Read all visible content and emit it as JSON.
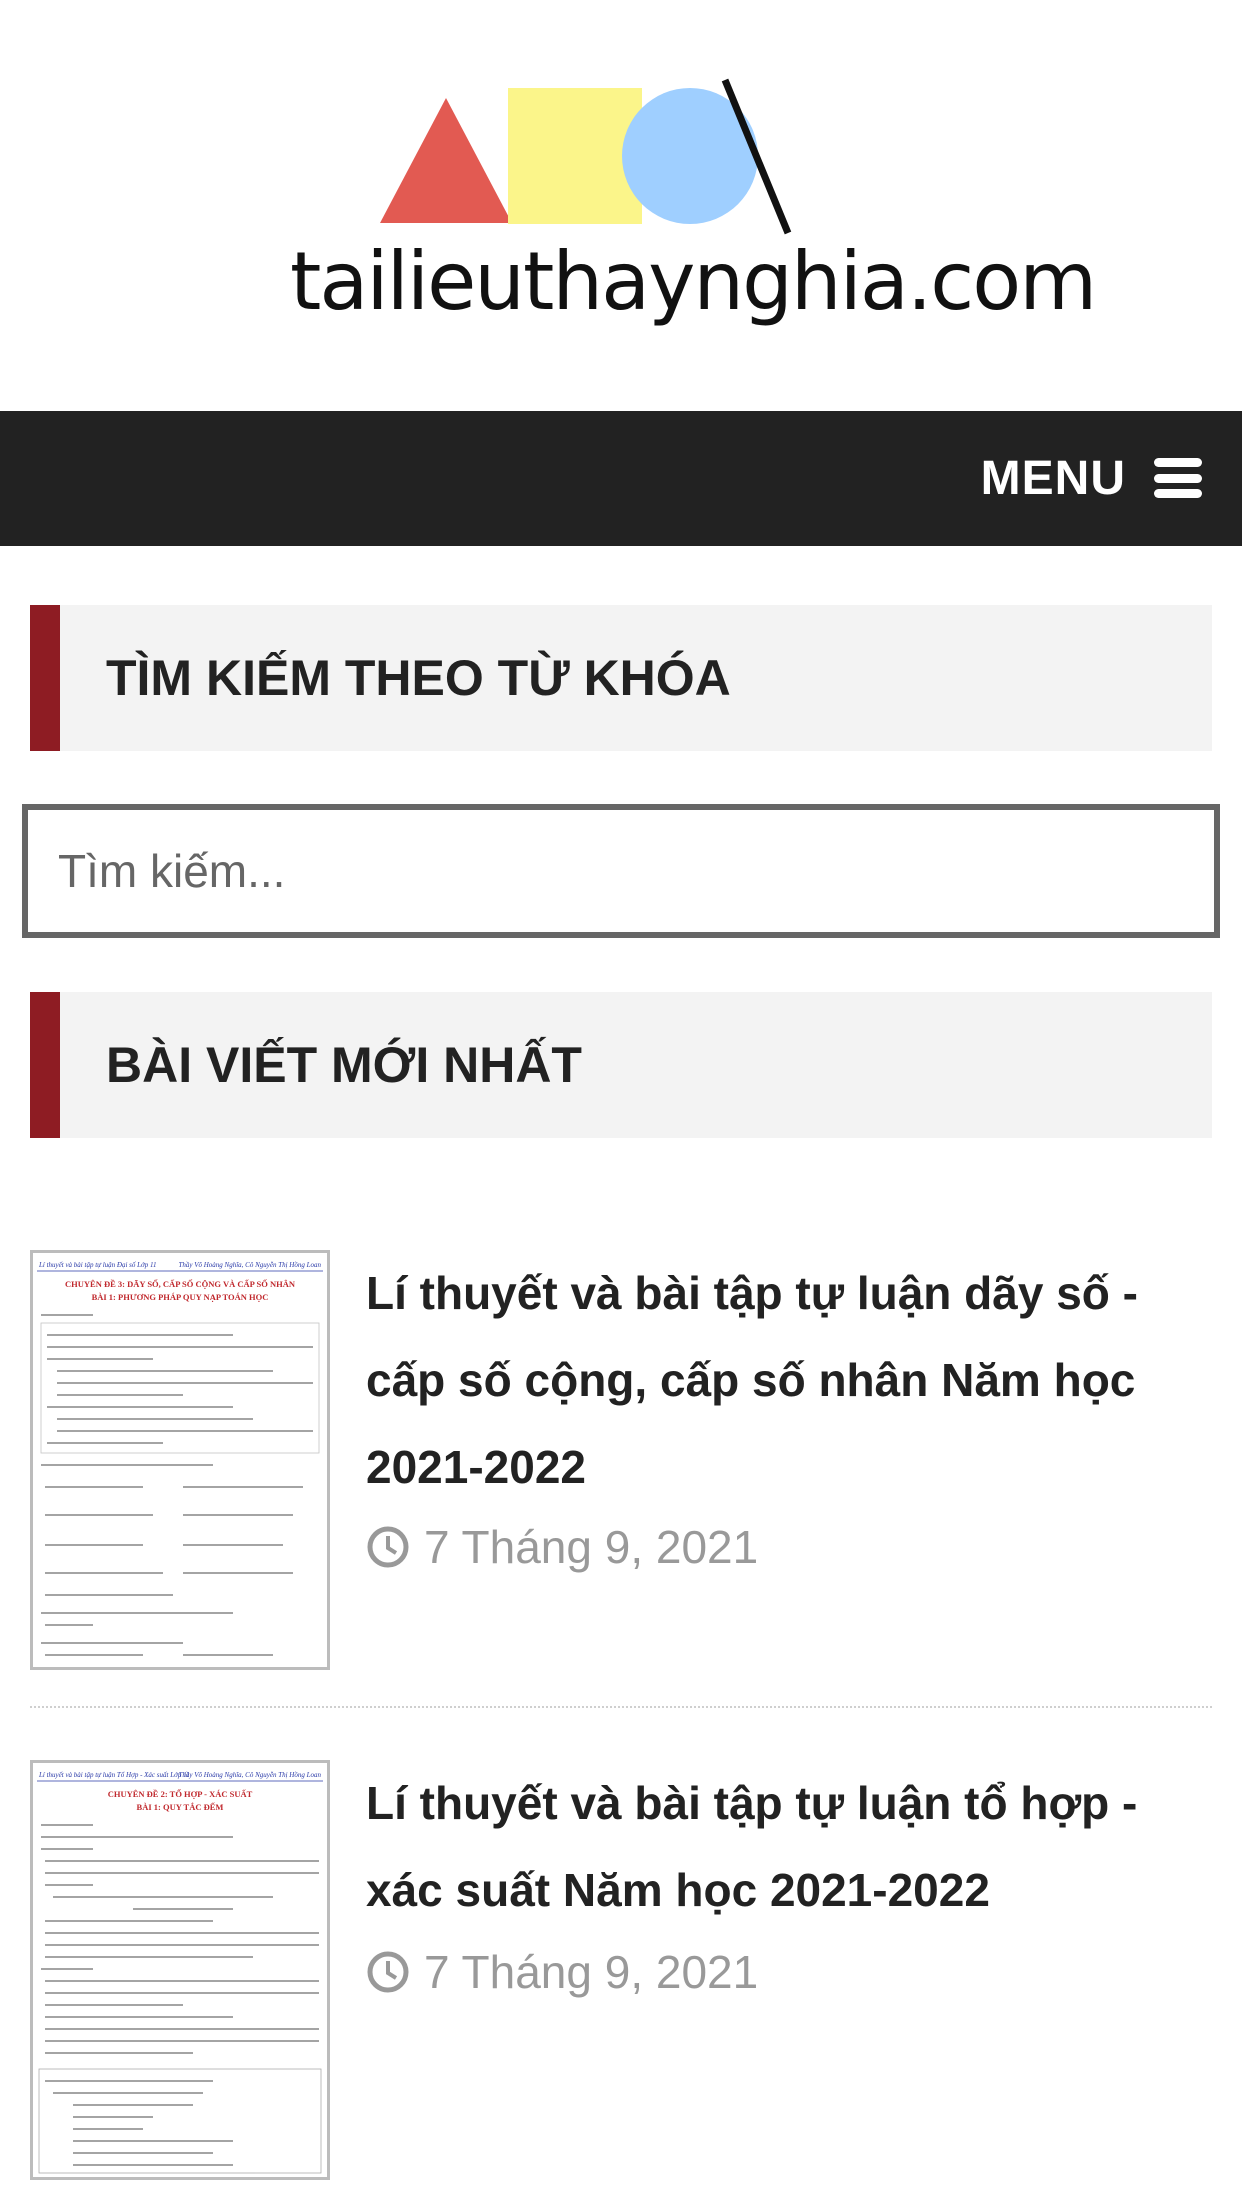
{
  "header": {
    "site_name": "tailieuthaynghia.com",
    "logo_colors": {
      "triangle": "#e25a52",
      "square": "#fbf58a",
      "circle": "#9fcfff"
    }
  },
  "nav": {
    "menu_label": "MENU",
    "menu_icon": "hamburger-icon"
  },
  "search_widget": {
    "title": "TÌM KIẾM THEO TỪ KHÓA",
    "placeholder": "Tìm kiếm..."
  },
  "recent_posts": {
    "title": "BÀI VIẾT MỚI NHẤT",
    "items": [
      {
        "title": "Lí thuyết và bài tập tự luận dãy số - cấp số cộng, cấp số nhân Năm học 2021-2022",
        "date": "7 Tháng 9, 2021",
        "thumb_header_left": "Lí thuyết và bài tập tự luận Đại số Lớp 11",
        "thumb_header_right": "Thầy Võ Hoàng Nghĩa, Cô Nguyễn Thị Hồng Loan",
        "thumb_title": "CHUYÊN ĐỀ 3: DÃY SỐ, CẤP SỐ CỘNG VÀ CẤP SỐ NHÂN",
        "thumb_subtitle": "BÀI 1: PHƯƠNG PHÁP QUY NẠP TOÁN HỌC"
      },
      {
        "title": "Lí thuyết và bài tập tự luận tổ hợp - xác suất Năm học 2021-2022",
        "date": "7 Tháng 9, 2021",
        "thumb_header_left": "Lí thuyết và bài tập tự luận Tổ Hợp - Xác suất Lớp 11",
        "thumb_header_right": "Thầy Võ Hoàng Nghĩa, Cô Nguyễn Thị Hồng Loan",
        "thumb_title": "CHUYÊN ĐỀ 2: TỔ HỢP - XÁC SUẤT",
        "thumb_subtitle": "BÀI 1: QUY TẮC ĐẾM"
      }
    ]
  },
  "colors": {
    "accent": "#8e1c23",
    "navbar": "#222222",
    "date_text": "#999999"
  }
}
